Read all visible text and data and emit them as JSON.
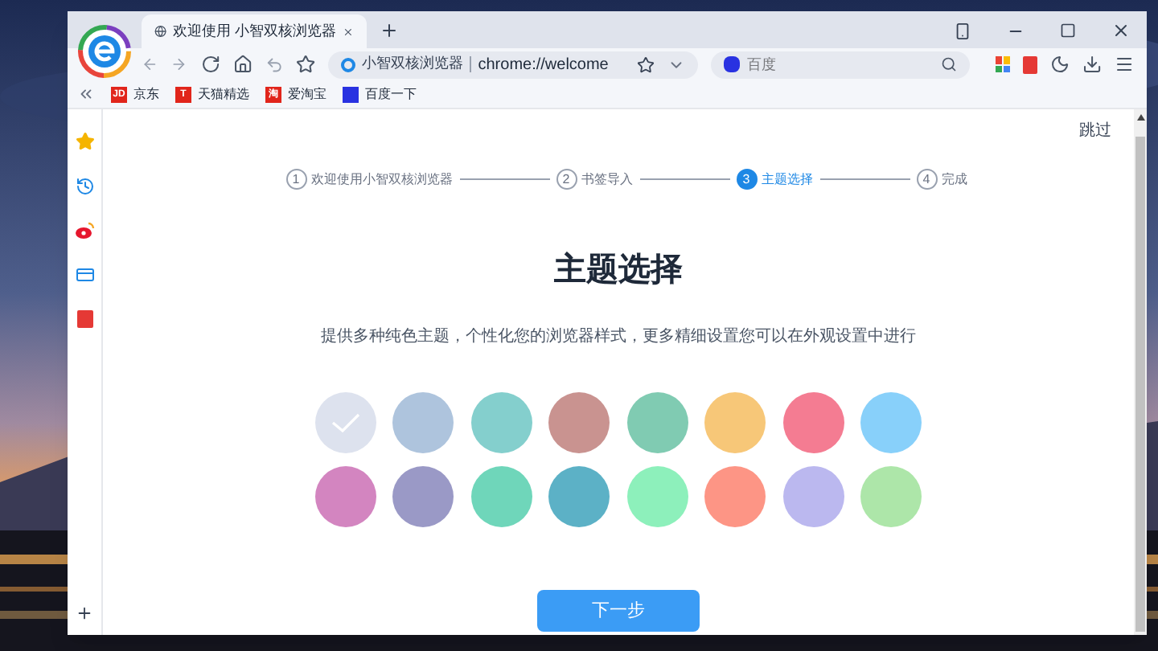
{
  "tab": {
    "title": "欢迎使用 小智双核浏览器"
  },
  "address": {
    "site": "小智双核浏览器",
    "url": "chrome://welcome"
  },
  "search": {
    "placeholder": "百度"
  },
  "bookmarks": [
    {
      "label": "京东",
      "badge": "JD",
      "color": "#e1251b"
    },
    {
      "label": "天猫精选",
      "badge": "T",
      "color": "#e1251b"
    },
    {
      "label": "爱淘宝",
      "badge": "淘",
      "color": "#e1251b"
    },
    {
      "label": "百度一下",
      "color": "#2932e1"
    }
  ],
  "skip": "跳过",
  "steps": [
    {
      "number": "1",
      "label": "欢迎使用小智双核浏览器",
      "selected": false
    },
    {
      "number": "2",
      "label": "书签导入",
      "selected": false
    },
    {
      "number": "3",
      "label": "主题选择",
      "selected": true
    },
    {
      "number": "4",
      "label": "完成",
      "selected": false
    }
  ],
  "heading": "主题选择",
  "description": "提供多种纯色主题，个性化您的浏览器样式，更多精细设置您可以在外观设置中进行",
  "themes": [
    {
      "color": "#dde2ee",
      "selected": true
    },
    {
      "color": "#aec4dd",
      "selected": false
    },
    {
      "color": "#84cfcd",
      "selected": false
    },
    {
      "color": "#c99390",
      "selected": false
    },
    {
      "color": "#80cbb2",
      "selected": false
    },
    {
      "color": "#f7c778",
      "selected": false
    },
    {
      "color": "#f47c92",
      "selected": false
    },
    {
      "color": "#88d0fa",
      "selected": false
    },
    {
      "color": "#d385c0",
      "selected": false
    },
    {
      "color": "#9a99c6",
      "selected": false
    },
    {
      "color": "#6fd6ba",
      "selected": false
    },
    {
      "color": "#5cb1c6",
      "selected": false
    },
    {
      "color": "#8df0bb",
      "selected": false
    },
    {
      "color": "#fd9585",
      "selected": false
    },
    {
      "color": "#bbb8ef",
      "selected": false
    },
    {
      "color": "#ade6a9",
      "selected": false
    }
  ],
  "next_button": "下一步"
}
